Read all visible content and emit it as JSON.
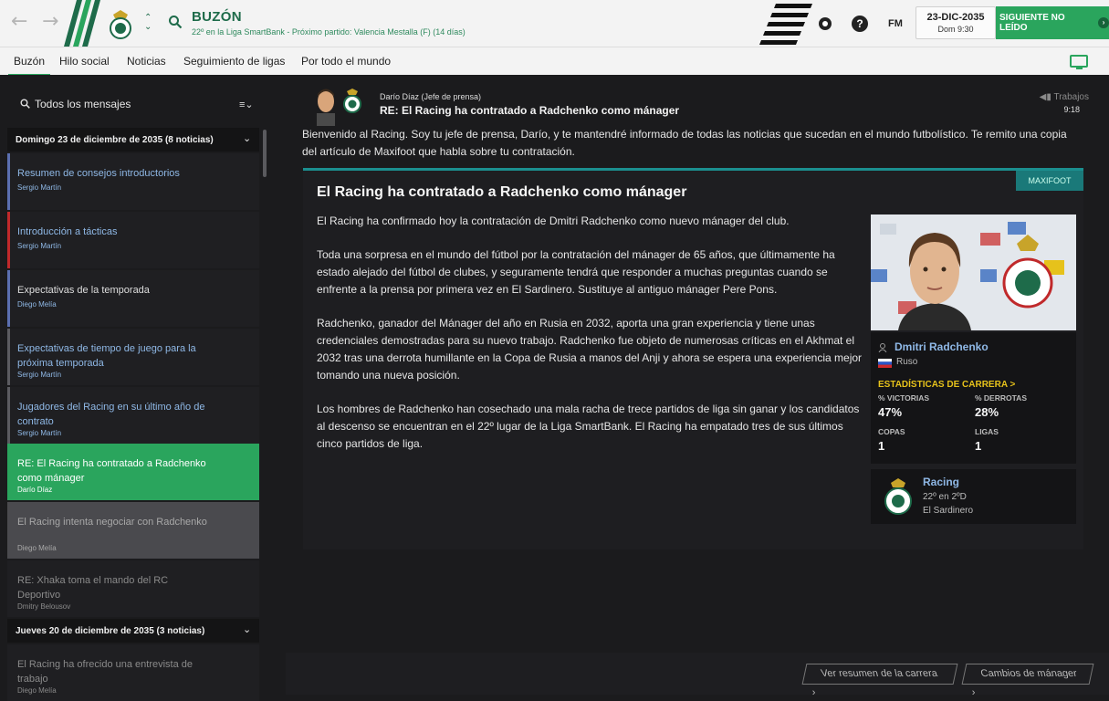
{
  "header": {
    "title": "BUZÓN",
    "subtitle": "22º en la Liga SmartBank - Próximo partido: Valencia Mestalla (F) (14 días)",
    "date": "23-DIC-2035",
    "day_time": "Dom 9:30",
    "next_button": "SIGUIENTE NO LEÍDO",
    "fm_label": "FM",
    "help_label": "?"
  },
  "tabs": [
    "Buzón",
    "Hilo social",
    "Noticias",
    "Seguimiento de ligas",
    "Por todo el mundo"
  ],
  "sidebar": {
    "filter_label": "Todos los mensajes",
    "groups": [
      {
        "label": "Domingo 23 de diciembre de 2035 (8 noticias)"
      },
      {
        "label": "Jueves 20 de diciembre de 2035 (3 noticias)"
      }
    ],
    "messages": [
      {
        "title": "Resumen de consejos introductorios",
        "sender": "Sergio Martín"
      },
      {
        "title": "Introducción a tácticas",
        "sender": "Sergio Martín"
      },
      {
        "title": "Expectativas de la temporada",
        "sender": "Diego Melía"
      },
      {
        "title": "Expectativas de tiempo de juego para la próxima temporada",
        "sender": "Sergio Martín"
      },
      {
        "title": "Jugadores del Racing en su último año de contrato",
        "sender": "Sergio Martín"
      },
      {
        "title": "RE: El Racing ha contratado a Radchenko como mánager",
        "sender": "Darío Díaz"
      },
      {
        "title": "El Racing intenta negociar con Radchenko",
        "sender": "Diego Melía"
      },
      {
        "title": "RE: Xhaka toma el mando del RC Deportivo",
        "sender": "Dmitry Belousov"
      },
      {
        "title": "El Racing ha ofrecido una entrevista de trabajo",
        "sender": "Diego Melía"
      }
    ]
  },
  "message": {
    "sender": "Darío Díaz  (Jefe de prensa)",
    "subject": "RE: El Racing ha contratado a Radchenko como mánager",
    "tag": "Trabajos",
    "time": "9:18",
    "intro": "Bienvenido al Racing. Soy tu jefe de prensa, Darío, y te mantendré informado de todas las noticias que sucedan en el mundo futbolístico. Te remito una copia del artículo de Maxifoot que habla sobre tu contratación."
  },
  "article": {
    "source": "MAXIFOOT",
    "title": "El Racing ha contratado a Radchenko como mánager",
    "paragraphs": [
      "El Racing ha confirmado hoy la contratación de Dmitri Radchenko como nuevo mánager del club.",
      "Toda una sorpresa en el mundo del fútbol por la contratación del mánager de 65 años, que últimamente ha estado alejado del fútbol de clubes, y seguramente tendrá que responder a muchas preguntas cuando se enfrente a la prensa por primera vez en El Sardinero. Sustituye al antiguo mánager Pere Pons.",
      "Radchenko, ganador del Mánager del año en Rusia en 2032, aporta una gran experiencia y tiene unas credenciales demostradas para su nuevo trabajo. Radchenko fue objeto de numerosas críticas en el Akhmat el 2032 tras una derrota humillante en la Copa de Rusia a manos del Anji y ahora se espera una experiencia mejor tomando una nueva posición.",
      "Los hombres de Radchenko han cosechado una mala racha de trece partidos de liga sin ganar y los candidatos al descenso se encuentran en el 22º lugar de la Liga SmartBank. El Racing ha empatado tres de sus últimos cinco partidos de liga."
    ]
  },
  "player": {
    "name": "Dmitri Radchenko",
    "nationality": "Ruso",
    "stats_header": "ESTADÍSTICAS DE CARRERA >",
    "wins_label": "% VICTORIAS",
    "wins": "47%",
    "losses_label": "% DERROTAS",
    "losses": "28%",
    "cups_label": "COPAS",
    "cups": "1",
    "leagues_label": "LIGAS",
    "leagues": "1"
  },
  "club": {
    "name": "Racing",
    "position": "22º en 2ºD",
    "stadium": "El Sardinero"
  },
  "footer": {
    "career_button": "Ver resumen de la carrera",
    "changes_button": "Cambios de mánager"
  },
  "colors": {
    "accent": "#2aa55d",
    "brand_dark": "#1e6b4a",
    "link": "#8fb8e6",
    "stats": "#e6c21b"
  }
}
